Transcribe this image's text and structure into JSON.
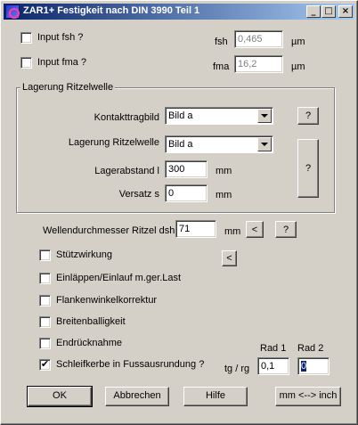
{
  "window": {
    "title": "ZAR1+  Festigkeit nach DIN 3990 Teil 1",
    "minimize_glyph": "_",
    "maximize_glyph": "□",
    "close_glyph": "×"
  },
  "fsh": {
    "checkbox_label": "Input fsh ?",
    "checked": false,
    "label": "fsh",
    "value": "0,465",
    "unit": "µm"
  },
  "fma": {
    "checkbox_label": "Input fma ?",
    "checked": false,
    "label": "fma",
    "value": "16,2",
    "unit": "µm"
  },
  "lagerung": {
    "group_title": "Lagerung Ritzelwelle",
    "kontakttragbild_label": "Kontakttragbild",
    "kontakttragbild_value": "Bild a",
    "lagerung_label": "Lagerung Ritzelwelle",
    "lagerung_value": "Bild a",
    "lagerabstand_label": "Lagerabstand l",
    "lagerabstand_value": "300",
    "lagerabstand_unit": "mm",
    "versatz_label": "Versatz s",
    "versatz_value": "0",
    "versatz_unit": "mm",
    "help1_label": "?",
    "help2_label": "?"
  },
  "wellendurchmesser": {
    "label": "Wellendurchmesser Ritzel dsh",
    "value": "71",
    "unit": "mm",
    "back_label": "<",
    "help_label": "?"
  },
  "options": [
    {
      "label": "Stützwirkung",
      "checked": false
    },
    {
      "label": "Einläppen/Einlauf m.ger.Last",
      "checked": false
    },
    {
      "label": "Flankenwinkelkorrektur",
      "checked": false
    },
    {
      "label": "Breitenballigkeit",
      "checked": false
    },
    {
      "label": "Endrücknahme",
      "checked": false
    },
    {
      "label": "Schleifkerbe in Fussausrundung ?",
      "checked": true
    }
  ],
  "stuetz_back_label": "<",
  "check_glyph": "✔",
  "rad": {
    "rad1_header": "Rad 1",
    "rad2_header": "Rad 2",
    "row_label": "tg / rg",
    "rad1_value": "0,1",
    "rad2_value": "0"
  },
  "buttons": {
    "ok": "OK",
    "abbrechen": "Abbrechen",
    "hilfe": "Hilfe",
    "units": "mm <--> inch"
  }
}
